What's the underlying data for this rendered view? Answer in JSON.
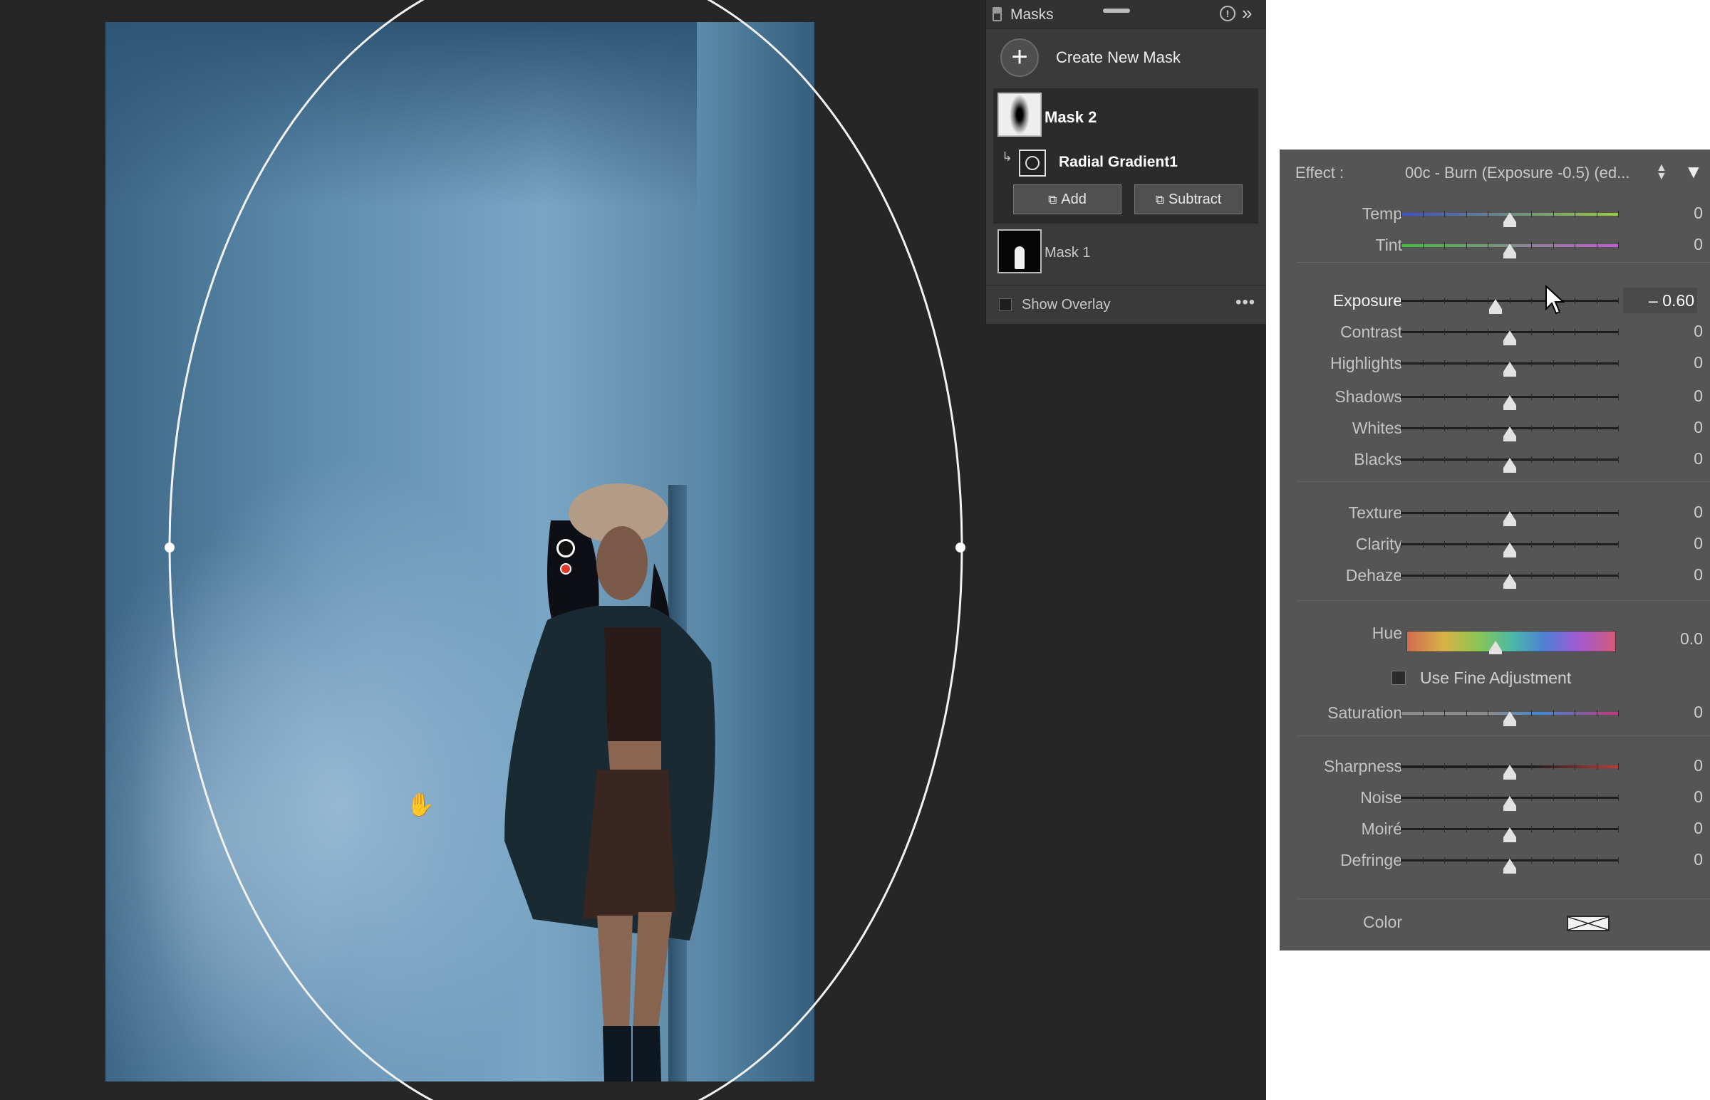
{
  "masks_panel": {
    "title": "Masks",
    "create_label": "Create New Mask",
    "mask2_label": "Mask 2",
    "radial_label": "Radial Gradient1",
    "add_label": "Add",
    "subtract_label": "Subtract",
    "mask1_label": "Mask 1",
    "overlay_label": "Show Overlay",
    "more": "•••"
  },
  "adjust_panel": {
    "effect_label": "Effect :",
    "effect_value": "00c - Burn (Exposure -0.5) (ed...",
    "sliders": [
      {
        "id": "temp",
        "label": "Temp",
        "value": "0",
        "pos": 0.5
      },
      {
        "id": "tint",
        "label": "Tint",
        "value": "0",
        "pos": 0.5
      },
      {
        "id": "exposure",
        "label": "Exposure",
        "value": "– 0.60",
        "pos": 0.435
      },
      {
        "id": "contrast",
        "label": "Contrast",
        "value": "0",
        "pos": 0.5
      },
      {
        "id": "highlights",
        "label": "Highlights",
        "value": "0",
        "pos": 0.5
      },
      {
        "id": "shadows",
        "label": "Shadows",
        "value": "0",
        "pos": 0.5
      },
      {
        "id": "whites",
        "label": "Whites",
        "value": "0",
        "pos": 0.5
      },
      {
        "id": "blacks",
        "label": "Blacks",
        "value": "0",
        "pos": 0.5
      },
      {
        "id": "texture",
        "label": "Texture",
        "value": "0",
        "pos": 0.5
      },
      {
        "id": "clarity",
        "label": "Clarity",
        "value": "0",
        "pos": 0.5
      },
      {
        "id": "dehaze",
        "label": "Dehaze",
        "value": "0",
        "pos": 0.5
      },
      {
        "id": "saturation",
        "label": "Saturation",
        "value": "0",
        "pos": 0.5
      },
      {
        "id": "sharpness",
        "label": "Sharpness",
        "value": "0",
        "pos": 0.5
      },
      {
        "id": "noise",
        "label": "Noise",
        "value": "0",
        "pos": 0.5
      },
      {
        "id": "moire",
        "label": "Moiré",
        "value": "0",
        "pos": 0.5
      },
      {
        "id": "defringe",
        "label": "Defringe",
        "value": "0",
        "pos": 0.5
      }
    ],
    "hue_label": "Hue",
    "hue_value": "0.0",
    "fine_label": "Use Fine Adjustment",
    "color_label": "Color"
  }
}
